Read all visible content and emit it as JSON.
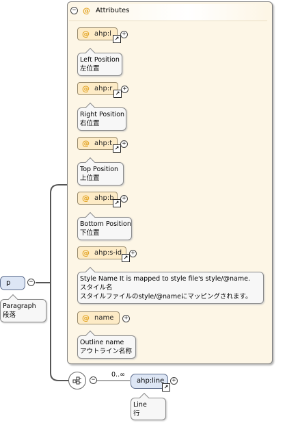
{
  "root": {
    "name": "p",
    "doc_en": "Paragraph",
    "doc_ja": "段落"
  },
  "attributes_group": {
    "label": "Attributes",
    "at_symbol": "@"
  },
  "attributes": [
    {
      "name": "ahp:l",
      "doc_lines": [
        "Left Position",
        "左位置"
      ]
    },
    {
      "name": "ahp:r",
      "doc_lines": [
        "Right Position",
        "右位置"
      ]
    },
    {
      "name": "ahp:t",
      "doc_lines": [
        "Top Position",
        "上位置"
      ]
    },
    {
      "name": "ahp:b",
      "doc_lines": [
        "Bottom Position",
        "下位置"
      ]
    },
    {
      "name": "ahp:s-id",
      "doc_lines": [
        "Style Name It is mapped to style file's style/@name.",
        "スタイル名",
        "スタイルファイルのstyle/@nameにマッピングされます。"
      ]
    },
    {
      "name": "name",
      "doc_lines": [
        "Outline name",
        "アウトライン名称"
      ]
    }
  ],
  "sequence": {
    "cardinality": "0..∞"
  },
  "child_element": {
    "name": "ahp:line",
    "doc_en": "Line",
    "doc_ja": "行"
  },
  "symbols": {
    "collapse": "−",
    "expand": "+",
    "link": "↗"
  },
  "icons": [
    "collapse-icon",
    "expand-icon",
    "link-arrow-icon",
    "sequence-icon"
  ],
  "colors": {
    "group_bg": "#fdf6e6",
    "attribute_bg": "#fdebc6",
    "attribute_at": "#e3a321",
    "element_bg": "#dde6f5",
    "note_bg": "#f7f7f7"
  }
}
